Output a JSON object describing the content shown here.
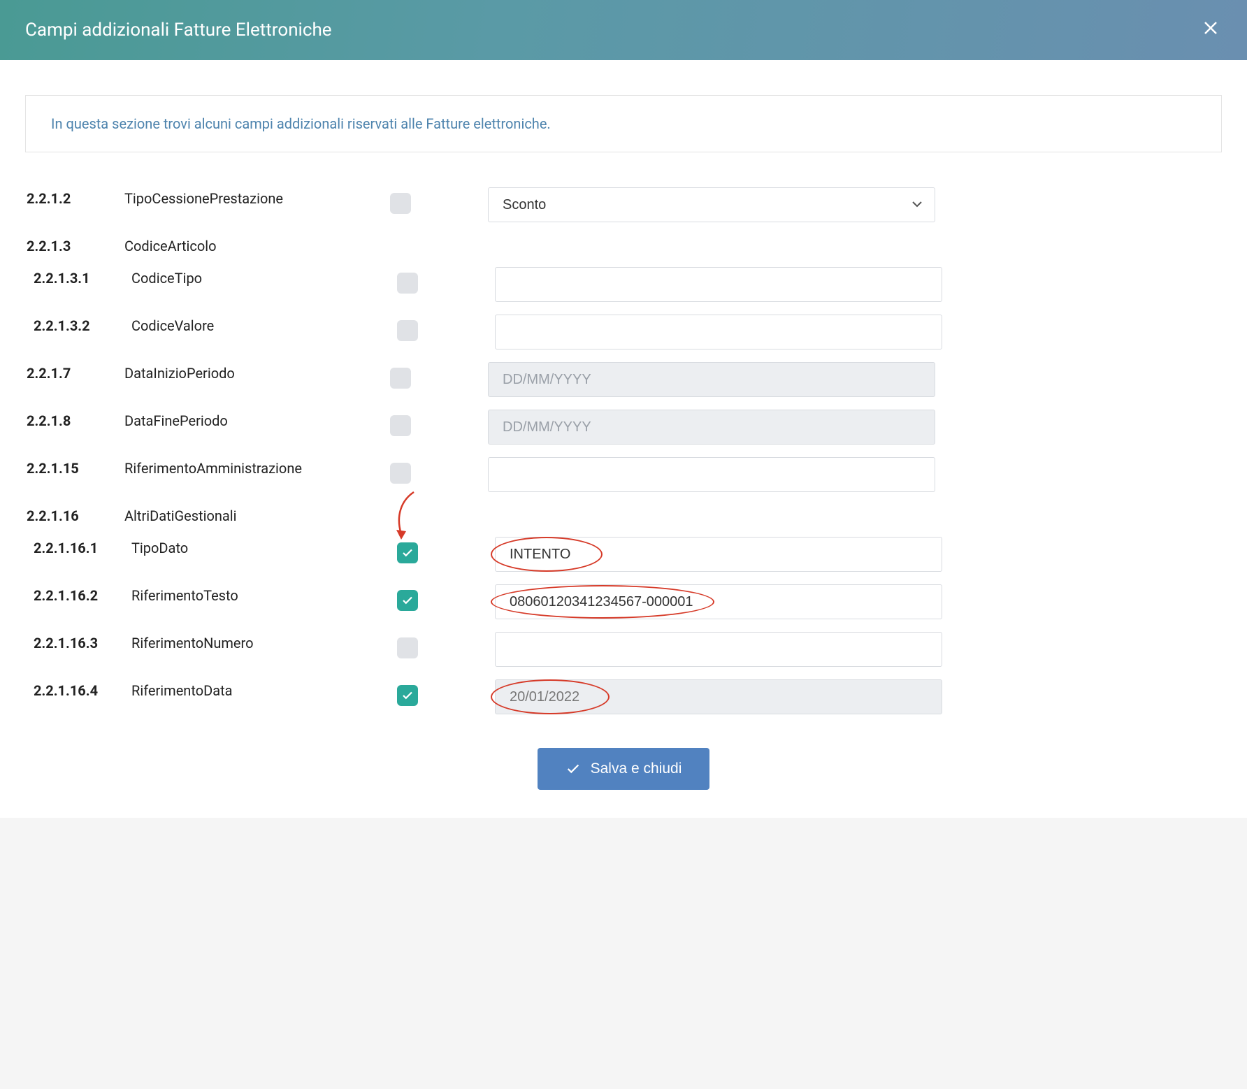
{
  "header": {
    "title": "Campi addizionali Fatture Elettroniche"
  },
  "info": {
    "text": "In questa sezione trovi alcuni campi addizionali riservati alle Fatture elettroniche."
  },
  "fields": {
    "f1": {
      "code": "2.2.1.2",
      "label": "TipoCessionePrestazione",
      "select_value": "Sconto"
    },
    "f2": {
      "code": "2.2.1.3",
      "label": "CodiceArticolo"
    },
    "f3": {
      "code": "2.2.1.3.1",
      "label": "CodiceTipo",
      "value": ""
    },
    "f4": {
      "code": "2.2.1.3.2",
      "label": "CodiceValore",
      "value": ""
    },
    "f5": {
      "code": "2.2.1.7",
      "label": "DataInizioPeriodo",
      "placeholder": "DD/MM/YYYY"
    },
    "f6": {
      "code": "2.2.1.8",
      "label": "DataFinePeriodo",
      "placeholder": "DD/MM/YYYY"
    },
    "f7": {
      "code": "2.2.1.15",
      "label": "RiferimentoAmministrazione",
      "value": ""
    },
    "f8": {
      "code": "2.2.1.16",
      "label": "AltriDatiGestionali"
    },
    "f9": {
      "code": "2.2.1.16.1",
      "label": "TipoDato",
      "value": "INTENTO"
    },
    "f10": {
      "code": "2.2.1.16.2",
      "label": "RiferimentoTesto",
      "value": "08060120341234567-000001"
    },
    "f11": {
      "code": "2.2.1.16.3",
      "label": "RiferimentoNumero",
      "value": ""
    },
    "f12": {
      "code": "2.2.1.16.4",
      "label": "RiferimentoData",
      "value": "20/01/2022"
    }
  },
  "footer": {
    "save": "Salva e chiudi"
  }
}
